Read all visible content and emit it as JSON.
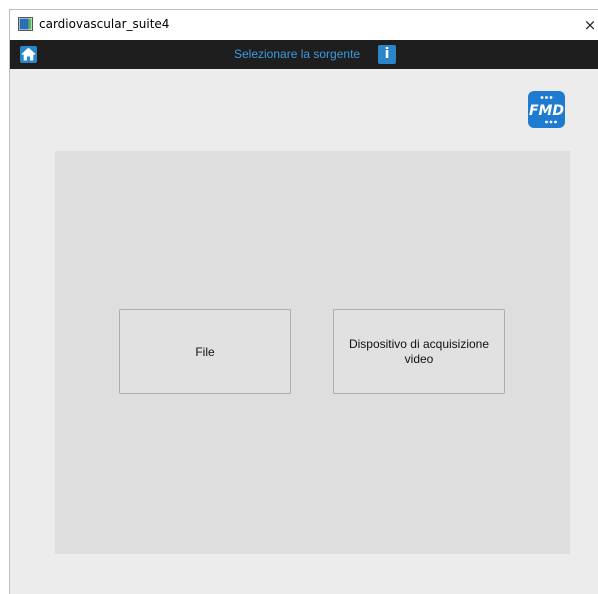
{
  "window": {
    "title": "cardiovascular_suite4",
    "close_glyph": "×"
  },
  "toolbar": {
    "home_icon": "home-icon",
    "title": "Selezionare la sorgente",
    "info_label": "i"
  },
  "logo": {
    "text": "FMD",
    "color": "#1f7bd0"
  },
  "sources": {
    "file_label": "File",
    "device_label": "Dispositivo di acquisizione video"
  },
  "colors": {
    "accent": "#2a86c8",
    "toolbar_bg": "#1e1e1e",
    "toolbar_text": "#3d9be0"
  }
}
